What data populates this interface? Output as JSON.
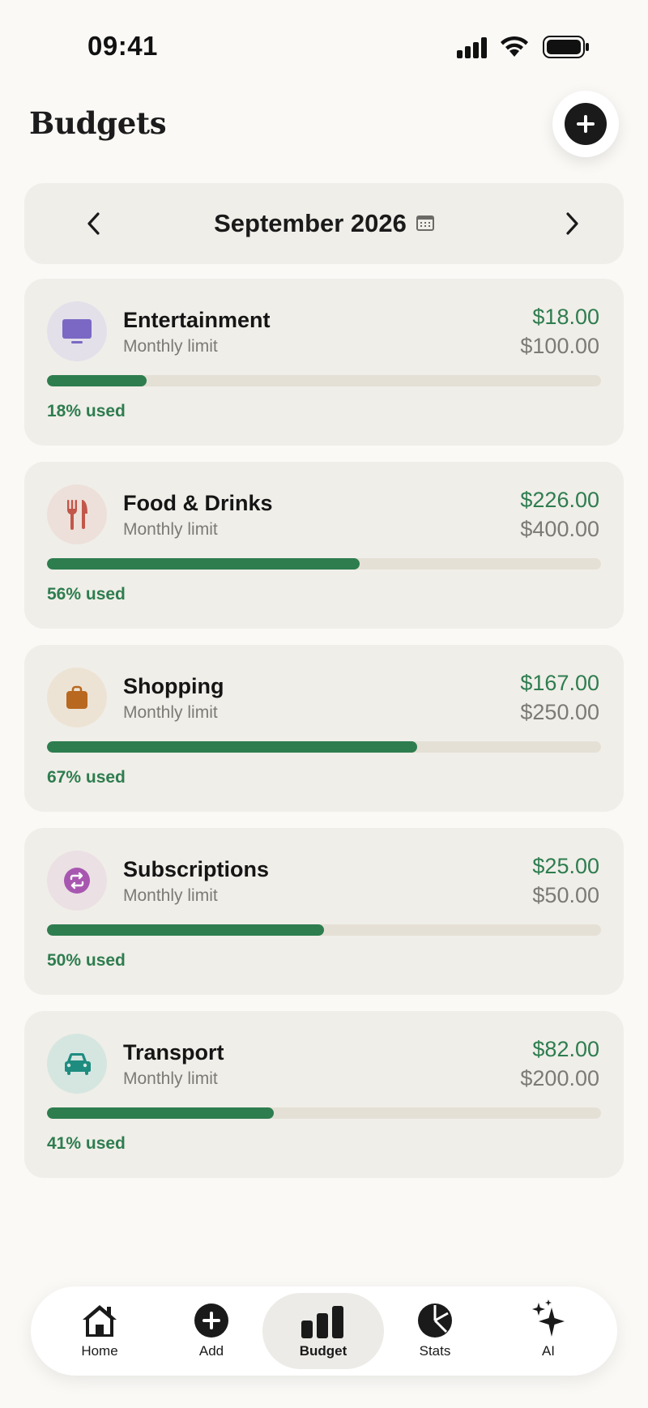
{
  "status": {
    "time": "09:41"
  },
  "header": {
    "title": "Budgets"
  },
  "month": {
    "label": "September 2026"
  },
  "colors": {
    "accent": "#2e7d4f",
    "track": "#e5e0d6",
    "card": "#f0eee9",
    "background": "#faf9f6"
  },
  "budgets": [
    {
      "name": "Entertainment",
      "subtitle": "Monthly limit",
      "spent": "$18.00",
      "limit": "$100.00",
      "used_label": "18% used",
      "progress": 0.18,
      "icon": "tv-icon",
      "icon_bg": "#e3e0ea",
      "icon_color": "#7b68c4"
    },
    {
      "name": "Food & Drinks",
      "subtitle": "Monthly limit",
      "spent": "$226.00",
      "limit": "$400.00",
      "used_label": "56% used",
      "progress": 0.565,
      "icon": "fork-knife-icon",
      "icon_bg": "#ede0da",
      "icon_color": "#c2564a"
    },
    {
      "name": "Shopping",
      "subtitle": "Monthly limit",
      "spent": "$167.00",
      "limit": "$250.00",
      "used_label": "67% used",
      "progress": 0.668,
      "icon": "shopping-bag-icon",
      "icon_bg": "#ede3d4",
      "icon_color": "#b8681f"
    },
    {
      "name": "Subscriptions",
      "subtitle": "Monthly limit",
      "spent": "$25.00",
      "limit": "$50.00",
      "used_label": "50% used",
      "progress": 0.5,
      "icon": "repeat-icon",
      "icon_bg": "#ebe0e4",
      "icon_color": "#a857b0"
    },
    {
      "name": "Transport",
      "subtitle": "Monthly limit",
      "spent": "$82.00",
      "limit": "$200.00",
      "used_label": "41% used",
      "progress": 0.41,
      "icon": "car-icon",
      "icon_bg": "#d5e6e0",
      "icon_color": "#1f8c80"
    }
  ],
  "tabs": [
    {
      "label": "Home",
      "icon": "home-icon",
      "active": false
    },
    {
      "label": "Add",
      "icon": "add-circle-icon",
      "active": false
    },
    {
      "label": "Budget",
      "icon": "bar-chart-icon",
      "active": true
    },
    {
      "label": "Stats",
      "icon": "pie-chart-icon",
      "active": false
    },
    {
      "label": "AI",
      "icon": "sparkles-icon",
      "active": false
    }
  ]
}
